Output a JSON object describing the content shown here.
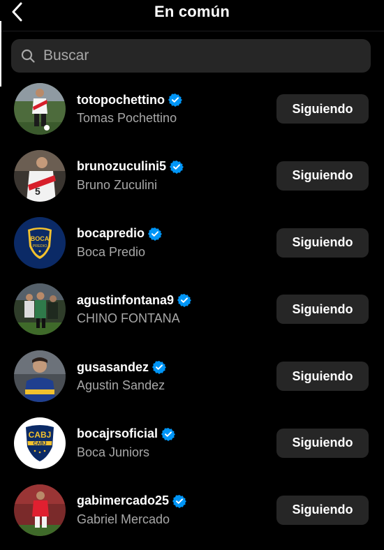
{
  "header": {
    "title": "En común",
    "back_icon": "chevron-left-icon"
  },
  "search": {
    "placeholder": "Buscar",
    "value": "",
    "icon": "search-icon"
  },
  "accounts": [
    {
      "username": "totopochettino",
      "full_name": "Tomas Pochettino",
      "verified": true,
      "button_label": "Siguiendo"
    },
    {
      "username": "brunozuculini5",
      "full_name": "Bruno Zuculini",
      "verified": true,
      "button_label": "Siguiendo"
    },
    {
      "username": "bocapredio",
      "full_name": "Boca Predio",
      "verified": true,
      "button_label": "Siguiendo"
    },
    {
      "username": "agustinfontana9",
      "full_name": "CHINO FONTANA",
      "verified": true,
      "button_label": "Siguiendo"
    },
    {
      "username": "gusasandez",
      "full_name": "Agustin Sandez",
      "verified": true,
      "button_label": "Siguiendo"
    },
    {
      "username": "bocajrsoficial",
      "full_name": "Boca Juniors",
      "verified": true,
      "button_label": "Siguiendo"
    },
    {
      "username": "gabimercado25",
      "full_name": "Gabriel Mercado",
      "verified": true,
      "button_label": "Siguiendo"
    }
  ],
  "colors": {
    "background": "#000000",
    "button_bg": "#262626",
    "secondary_text": "#a8a8a8",
    "verified_blue": "#0095f6"
  },
  "logo_text": {
    "boca_predio_top": "BOCA",
    "boca_predio_bottom": "PREDIO",
    "boca_juniors": "CABJ"
  }
}
